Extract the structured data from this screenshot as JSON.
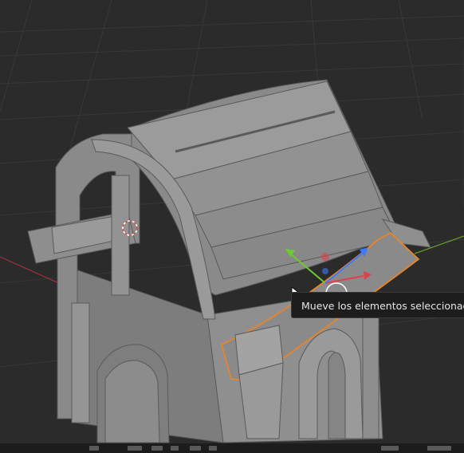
{
  "viewport": {
    "background": "#2b2b2b",
    "grid_color": "#3a3a3a",
    "x_axis_color": "#a8323c",
    "y_axis_color": "#6a9a2a"
  },
  "object": {
    "base_color": "#8e8e8e",
    "selection_outline_color": "#e8842a"
  },
  "gizmo": {
    "x_color": "#e0404a",
    "y_color": "#6ccc2c",
    "z_color": "#3a7aff"
  },
  "tooltip": {
    "text": "Mueve los elementos seleccionados"
  },
  "icons": [
    "3d-cursor-icon",
    "mouse-cursor-icon",
    "move-gizmo-icon"
  ]
}
